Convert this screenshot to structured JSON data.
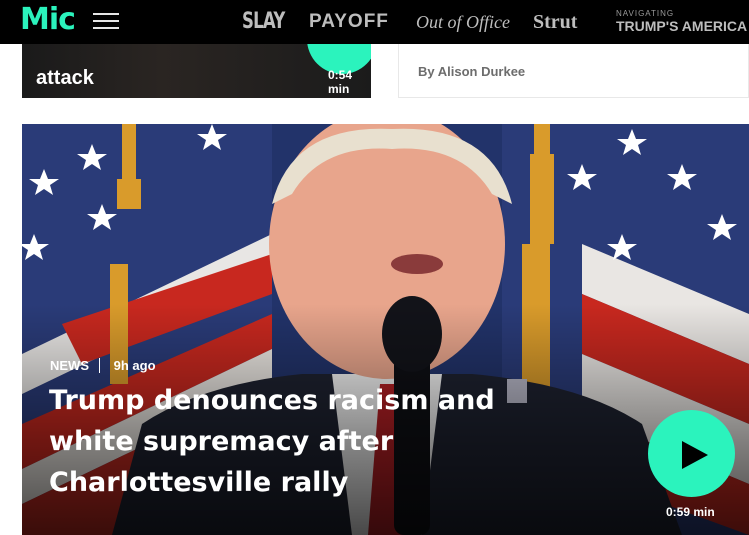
{
  "header": {
    "logo": "Mic",
    "nav": {
      "slay": "SLAY",
      "payoff": "PAYOFF",
      "out_of_office": "Out of Office",
      "strut": "Strut",
      "trumps_america_small": "NAVIGATING",
      "trumps_america": "TRUMP'S AMERICA"
    }
  },
  "top_cards": {
    "left": {
      "title": "attack",
      "duration": "0:54 min"
    },
    "right": {
      "author": "By Alison Durkee"
    }
  },
  "hero": {
    "category": "NEWS",
    "time": "9h ago",
    "title": "Trump denounces racism and white supremacy after Charlottesville rally",
    "duration": "0:59 min"
  },
  "colors": {
    "accent": "#2bf3bd",
    "nav_bg": "#000000"
  }
}
